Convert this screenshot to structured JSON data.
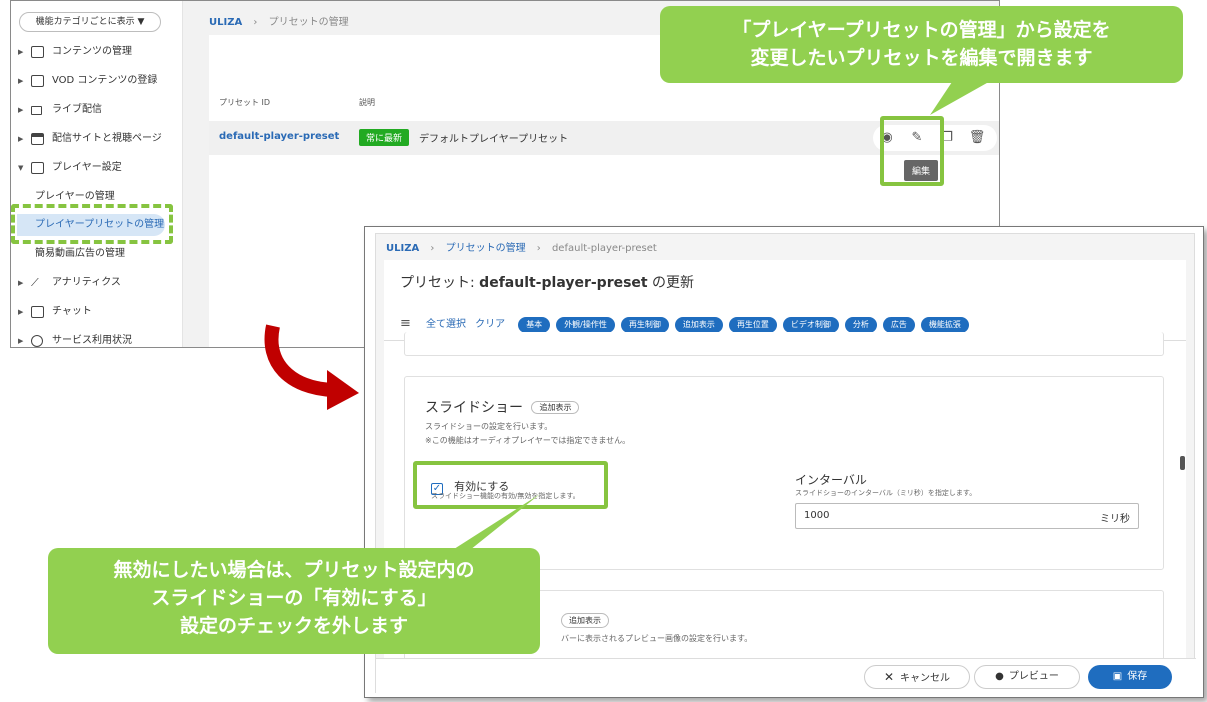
{
  "screenshot1": {
    "sidebar": {
      "filter_button": "機能カテゴリごとに表示 ▼",
      "items": [
        {
          "label": "コンテンツの管理",
          "icon": "play-square-icon"
        },
        {
          "label": "VOD コンテンツの登録",
          "icon": "plus-square-icon"
        },
        {
          "label": "ライブ配信",
          "icon": "camera-icon"
        },
        {
          "label": "配信サイトと視聴ページ",
          "icon": "window-icon"
        },
        {
          "label": "プレイヤー設定",
          "icon": "player-settings-icon"
        }
      ],
      "subitems": [
        "プレイヤーの管理",
        "プレイヤープリセットの管理",
        "簡易動画広告の管理"
      ],
      "lower_items": [
        {
          "label": "アナリティクス",
          "icon": "analytics-icon"
        },
        {
          "label": "チャット",
          "icon": "chat-icon"
        },
        {
          "label": "サービス利用状況",
          "icon": "usage-icon"
        }
      ]
    },
    "breadcrumb": {
      "root": "ULIZA",
      "sep": "›",
      "current": "プリセットの管理"
    },
    "table": {
      "col_id": "プリセット ID",
      "col_desc": "説明",
      "row": {
        "id": "default-player-preset",
        "badge": "常に最新",
        "description": "デフォルトプレイヤープリセット"
      }
    },
    "edit_tooltip": "編集"
  },
  "callout_top": {
    "line1": "「プレイヤープリセットの管理」から設定を",
    "line2": "変更したいプリセットを編集で開きます"
  },
  "screenshot2": {
    "breadcrumb": {
      "root": "ULIZA",
      "sep": "›",
      "mid": "プリセットの管理",
      "current": "default-player-preset"
    },
    "title_prefix": "プリセット: ",
    "title_name": "default-player-preset",
    "title_suffix": " の更新",
    "filter": {
      "select_all": "全て選択",
      "clear": "クリア"
    },
    "chips": [
      "基本",
      "外観/操作性",
      "再生制御",
      "追加表示",
      "再生位置",
      "ビデオ制御",
      "分析",
      "広告",
      "機能拡張"
    ],
    "slideshow": {
      "title": "スライドショー",
      "badge": "追加表示",
      "desc1": "スライドショーの設定を行います。",
      "desc2": "※この機能はオーディオプレイヤーでは指定できません。",
      "enable_label": "有効にする",
      "enable_desc": "スライドショー機能の有効/無効を指定します。",
      "interval_label": "インターバル",
      "interval_desc": "スライドショーのインターバル（ミリ秒）を指定します。",
      "interval_value": "1000",
      "interval_unit": "ミリ秒"
    },
    "next_section": {
      "badge": "追加表示",
      "desc": "バーに表示されるプレビュー画像の設定を行います。"
    },
    "footer": {
      "cancel": "キャンセル",
      "preview": "プレビュー",
      "save": "保存"
    }
  },
  "callout_bottom": {
    "line1": "無効にしたい場合は、プリセット設定内の",
    "line2": "スライドショーの「有効にする」",
    "line3": "設定のチェックを外します"
  },
  "colors": {
    "accent": "#1f6dbf",
    "callout": "#92d050",
    "badge_green": "#22aa22",
    "arrow": "#c00000"
  }
}
